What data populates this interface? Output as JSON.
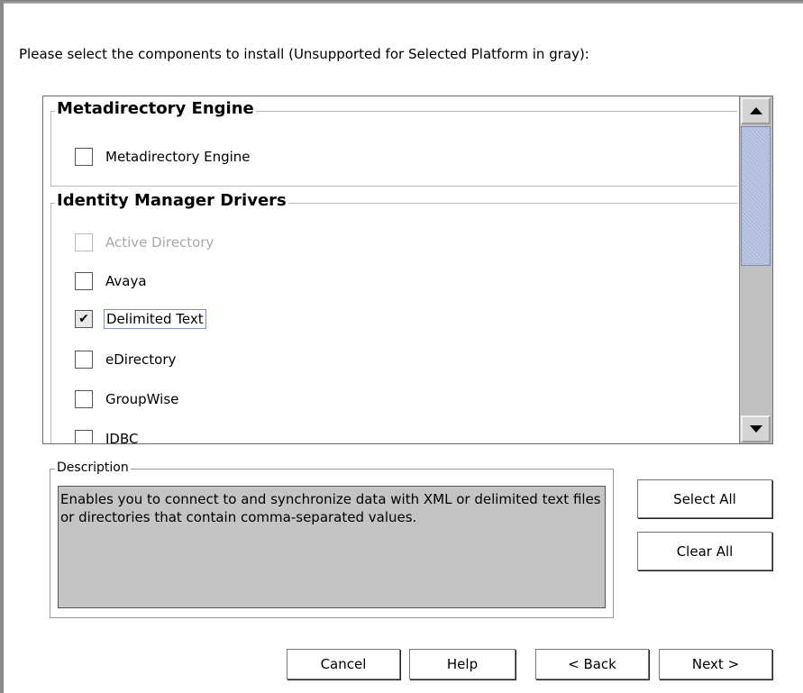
{
  "instruction": "Please select the components to install (Unsupported for Selected Platform in gray):",
  "groups": [
    {
      "title": "Metadirectory Engine",
      "items": [
        {
          "label": "Metadirectory Engine",
          "checked": false,
          "disabled": false
        }
      ]
    },
    {
      "title": "Identity Manager Drivers",
      "items": [
        {
          "label": "Active Directory",
          "checked": false,
          "disabled": true
        },
        {
          "label": "Avaya",
          "checked": false,
          "disabled": false
        },
        {
          "label": "Delimited Text",
          "checked": true,
          "disabled": false
        },
        {
          "label": "eDirectory",
          "checked": false,
          "disabled": false
        },
        {
          "label": "GroupWise",
          "checked": false,
          "disabled": false
        },
        {
          "label": "JDBC",
          "checked": false,
          "disabled": false
        }
      ]
    }
  ],
  "description": {
    "legend": "Description",
    "text": "Enables you to connect to and synchronize data with XML or delimited text files or directories that contain comma-separated values."
  },
  "buttons": {
    "select_all": "Select All",
    "clear_all": "Clear All",
    "cancel": "Cancel",
    "help": "Help",
    "back": "< Back",
    "next": "Next >"
  },
  "check_mark": "✔"
}
